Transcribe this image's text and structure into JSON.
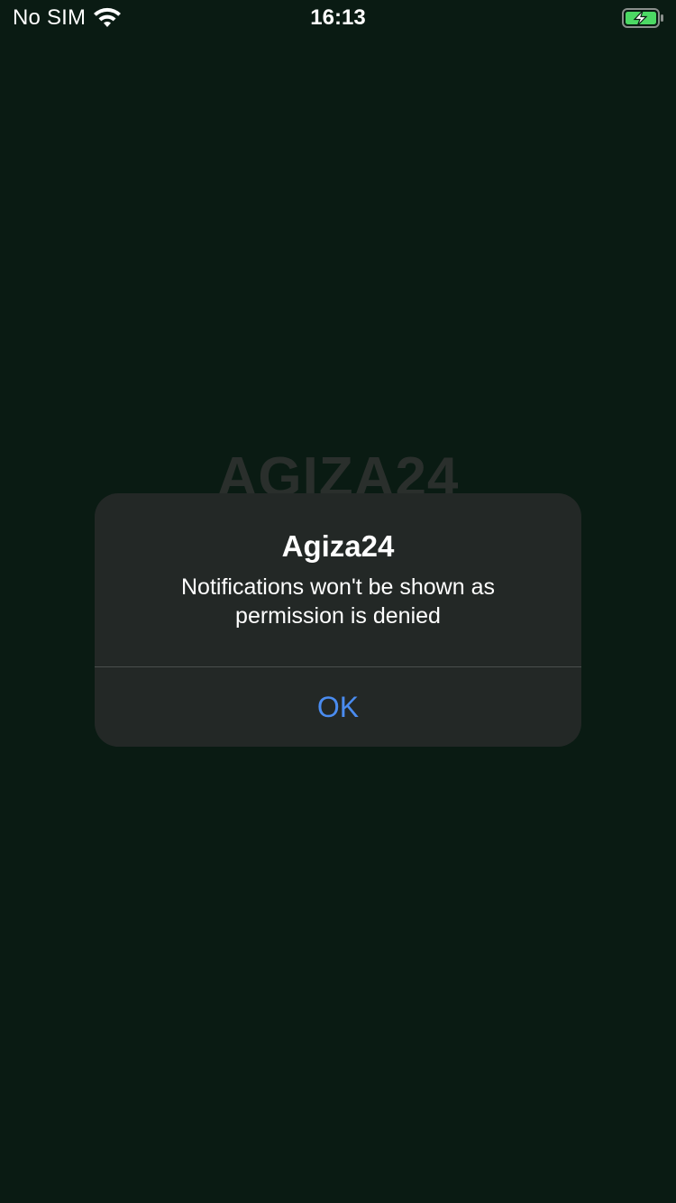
{
  "status_bar": {
    "carrier": "No SIM",
    "time": "16:13",
    "wifi_icon": "wifi-icon",
    "battery_icon": "battery-charging-icon",
    "battery_color": "#4cd964"
  },
  "background": {
    "logo_text": "AGIZA24",
    "color": "#0a1b13"
  },
  "alert": {
    "title": "Agiza24",
    "message": "Notifications won't be shown as permission is denied",
    "button_label": "OK",
    "button_color": "#4a8cf0"
  }
}
